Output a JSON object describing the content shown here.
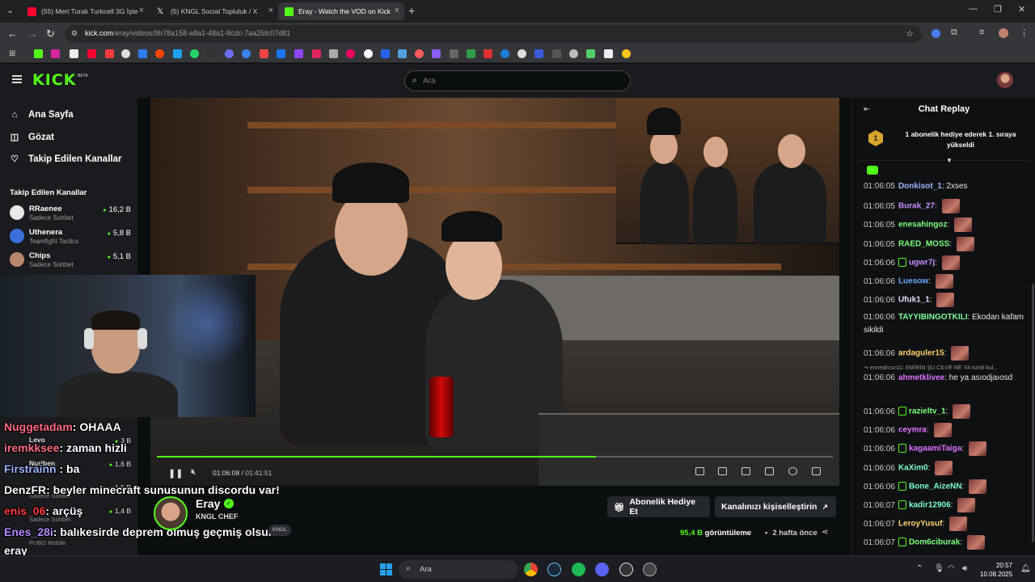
{
  "browser": {
    "tabs": [
      {
        "title": "(55) Mert Turak Turkcell 3G İşte",
        "favicon_color": "#ff0033",
        "active": false
      },
      {
        "title": "(5) KNGL Social Topluluk / X",
        "favicon_color": "#ffffff",
        "active": false
      },
      {
        "title": "Eray - Watch the VOD on Kick",
        "favicon_color": "#53fc18",
        "active": true
      }
    ],
    "url_host": "kick.com",
    "url_path": "/eray/videos/9b78a158-a8a1-48a1-8cdc-7aa25fc07d81"
  },
  "kick": {
    "logo": "KICK",
    "logo_sup": "BETA",
    "search_placeholder": "Ara",
    "accent": "#53fc18"
  },
  "sidebar": {
    "nav": [
      {
        "label": "Ana Sayfa",
        "icon": "home-icon"
      },
      {
        "label": "Gözat",
        "icon": "compass-icon"
      },
      {
        "label": "Takip Edilen Kanallar",
        "icon": "heart-icon"
      }
    ],
    "followed_title": "Takip Edilen Kanallar",
    "channels": [
      {
        "name": "RRaenee",
        "game": "Sadece Sohbet",
        "viewers": "16,2 B"
      },
      {
        "name": "Uthenera",
        "game": "Teamfight Tactics",
        "viewers": "5,8 B"
      },
      {
        "name": "Chips",
        "game": "Sadece Sohbet",
        "viewers": "5,1 B"
      }
    ],
    "channels_behind_overlay": [
      {
        "name": "Levo",
        "viewers": "3 B"
      },
      {
        "name": "Nuriben",
        "viewers": "1,6 B"
      },
      {
        "name": "",
        "game": "Sadece Sohbet",
        "viewers": "1,5 B"
      },
      {
        "name": "",
        "game": "Sadece Sohbet",
        "viewers": "1,4 B"
      },
      {
        "name": "",
        "game": "PUBG Mobile",
        "viewers": ""
      }
    ]
  },
  "player": {
    "current_time": "01:06:08",
    "separator": "/",
    "duration": "01:41:51",
    "progress": 0.65
  },
  "overlay_chat": [
    {
      "user": "Nuggetadam",
      "color": "#ff6b81",
      "text": ": OHAAA"
    },
    {
      "user": "iremkksee",
      "color": "#ff6b81",
      "text": ": zaman hizli"
    },
    {
      "user": "Firstrainn",
      "color": "#9ab4ff",
      "text": " : ba"
    },
    {
      "user": "DenzFR",
      "color": "#ffffff",
      "text": ": beyler minecraft sunusunun discordu var!"
    },
    {
      "user": "enis_06",
      "color": "#ff3b3b",
      "text": ": arçüş"
    },
    {
      "user": "Enes_28i",
      "color": "#b58cff",
      "text": ": balıkesirde deprem olmuş geçmiş olsun"
    },
    {
      "user": "eray",
      "color": "#ffffff",
      "text": ""
    }
  ],
  "channel": {
    "name": "Eray",
    "title": "KNGL CHEF",
    "tag": "KNGL",
    "subscribe_gift": "Abonelik Hediye Et",
    "customize": "Kanalınızı kişiselleştirin",
    "views_number": "95,4 B",
    "views_label": "görüntüleme",
    "ago": "2 hafta önce"
  },
  "chat": {
    "title": "Chat Replay",
    "pinned_rank": "1",
    "pinned_text": "1 abonelik hediye ederek 1. sıraya yükseldi",
    "reply_preview": "emredrssn11: EMİRİN ŞU CİLVE NE YA isimli kul...",
    "messages": [
      {
        "time": "01:06:05",
        "user": "Donkisot_1",
        "color": "#9ab4ff",
        "text": "2xses",
        "emote": false,
        "badge": false
      },
      {
        "time": "01:06:05",
        "user": "Burak_27",
        "color": "#c58cff",
        "text": "",
        "emote": true,
        "badge": false
      },
      {
        "time": "01:06:05",
        "user": "enesahingoz",
        "color": "#7cff7c",
        "text": "",
        "emote": true,
        "badge": false
      },
      {
        "time": "01:06:05",
        "user": "RAED_MOSS",
        "color": "#7cff7c",
        "text": "",
        "emote": true,
        "badge": false
      },
      {
        "time": "01:06:06",
        "user": "ugwr7j",
        "color": "#c58cff",
        "text": "",
        "emote": true,
        "badge": true
      },
      {
        "time": "01:06:06",
        "user": "Luesow",
        "color": "#6aa8ff",
        "text": "",
        "emote": true,
        "badge": false
      },
      {
        "time": "01:06:06",
        "user": "Ufuk1_1",
        "color": "#e0e0ff",
        "text": "",
        "emote": true,
        "badge": false
      },
      {
        "time": "01:06:06",
        "user": "TAYYIBINGOTKILI",
        "color": "#7cff9a",
        "text": "Ekodan kafam sikildi",
        "emote": false,
        "badge": false
      },
      {
        "time": "01:06:06",
        "user": "ardaguler15",
        "color": "#ffd36b",
        "text": "",
        "emote": true,
        "badge": false
      },
      {
        "time": "01:06:06",
        "user": "ahmetklivee",
        "color": "#e070ff",
        "text": "he ya asıodjaıosd",
        "emote": false,
        "badge": false
      },
      {
        "time": "01:06:06",
        "user": "razieltv_1",
        "color": "#7cff7c",
        "text": "",
        "emote": true,
        "badge": true
      },
      {
        "time": "01:06:06",
        "user": "ceymra",
        "color": "#e070ff",
        "text": "",
        "emote": true,
        "badge": false
      },
      {
        "time": "01:06:06",
        "user": "kagaamiTaiga",
        "color": "#e070ff",
        "text": "",
        "emote": true,
        "badge": true
      },
      {
        "time": "01:06:06",
        "user": "KaXim0",
        "color": "#7cffd0",
        "text": "",
        "emote": true,
        "badge": false
      },
      {
        "time": "01:06:06",
        "user": "Bone_AizeNN",
        "color": "#7cffd0",
        "text": "",
        "emote": true,
        "badge": true
      },
      {
        "time": "01:06:07",
        "user": "kadir12906",
        "color": "#7cffd0",
        "text": "",
        "emote": true,
        "badge": true
      },
      {
        "time": "01:06:07",
        "user": "LeroyYusuf",
        "color": "#ffd36b",
        "text": "",
        "emote": true,
        "badge": false
      },
      {
        "time": "01:06:07",
        "user": "Dom6ciburak",
        "color": "#7cff7c",
        "text": "",
        "emote": true,
        "badge": true
      }
    ]
  },
  "taskbar": {
    "search": "Ara",
    "time": "20:57",
    "date": "10.08.2025"
  }
}
